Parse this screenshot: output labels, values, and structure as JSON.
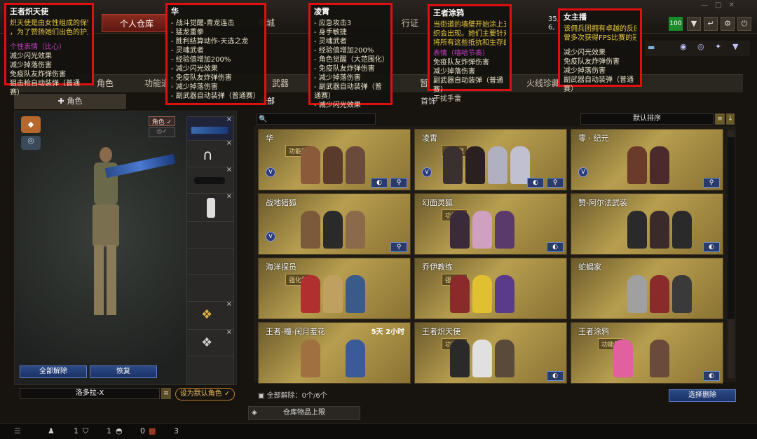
{
  "topbar": {
    "tabs": [
      "个人仓库",
      "商城",
      "行证"
    ],
    "partial_num1": "35,",
    "partial_num2": "6,",
    "level_badge": "100"
  },
  "sub_tabs": [
    "角色",
    "功能道具",
    "武器",
    "暂",
    "火线珍藏"
  ],
  "sub_tab_sel": "全部",
  "sub_tab2": "首饰",
  "left": {
    "role_tab": "角色",
    "role_toggle": "角色",
    "clear_all": "全部解除",
    "restore": "恢复",
    "char_name": "洛多拉-X",
    "set_default": "设为默认角色"
  },
  "sort": {
    "label": "默认排序"
  },
  "cards": [
    {
      "name": "华",
      "badge": "功能型"
    },
    {
      "name": "凌霄",
      "badge": "功能型"
    },
    {
      "name": "零 · 纪元",
      "badge": ""
    },
    {
      "name": "战地猎狐",
      "badge": ""
    },
    {
      "name": "幻面灵狐",
      "badge": "功能型"
    },
    {
      "name": "赞-阿尔法武装",
      "badge": ""
    },
    {
      "name": "海洋探员",
      "badge": "强化型"
    },
    {
      "name": "乔伊教练",
      "badge": "强化型"
    },
    {
      "name": "蛇蝎家",
      "badge": ""
    },
    {
      "name": "王者-瞳-闰月羞花",
      "badge": "",
      "timer": "5天 2小时"
    },
    {
      "name": "王者炽天使",
      "badge": "功能型"
    },
    {
      "name": "王者涂鸦",
      "badge": "功能型"
    }
  ],
  "bottom": {
    "clear_label": "全部解除：",
    "clear_count": "0个/6个",
    "select_remove": "选择删除",
    "storage_limit": "仓库物品上限"
  },
  "status": {
    "v1": "1",
    "v2": "1",
    "v3": "0",
    "v4": "3"
  },
  "popups": [
    {
      "title": "王者炽天使",
      "lines": [
        "炽天使是由女性组成的保镖公司",
        "，为了赞扬她们出色的护卫能力"
      ],
      "purple": [
        "个性表情（比心）"
      ],
      "bullets": [
        "减少闪光效果",
        "减少掉落伤害",
        "免疫队友炸弹伤害",
        "狙击枪自动装弹（普通赛）"
      ]
    },
    {
      "title": "华",
      "bullets": [
        "- 战斗觉醒-青龙连击",
        "- 猛龙重拳",
        "- 胜利结算动作-天选之龙",
        "- 灵魂武者",
        "- 经验值增加200%",
        "- 减少闪光效果",
        "- 免疫队友炸弹伤害",
        "- 减少掉落伤害",
        "- 副武器自动装弹（普通赛）"
      ]
    },
    {
      "title": "凌霄",
      "bullets": [
        "- 应急攻击3",
        "- 身手敏捷",
        "- 灵魂武者",
        "- 经验值增加200%",
        "- 角色觉醒（大范围化）",
        "- 免疫队友炸弹伤害",
        "- 减少掉落伤害",
        "- 副武器自动装弹（普通赛）",
        "- 减少闪光效果"
      ]
    },
    {
      "title": "王者涂鸦",
      "lines": [
        "当街道的墙壁开始涂上五颜六色的涂",
        "织会出现。她们主要针对贪婪的权力",
        "将所有这些抵抗和生存的过程升华成"
      ],
      "purple": [
        "表情（嘻哈节奏）"
      ],
      "bullets": [
        "免疫队友炸弹伤害",
        "减少掉落伤害",
        "副武器自动装弹（普通赛）",
        "干扰手雷"
      ]
    },
    {
      "title": "女主播",
      "lines": [
        "该佣兵团拥有卓越的反应能力",
        "曾多次获得FPS比赛的冠军"
      ],
      "bullets": [
        "减少闪光效果",
        "免疫队友炸弹伤害",
        "减少掉落伤害",
        "副武器自动装弹（普通赛）"
      ]
    }
  ]
}
